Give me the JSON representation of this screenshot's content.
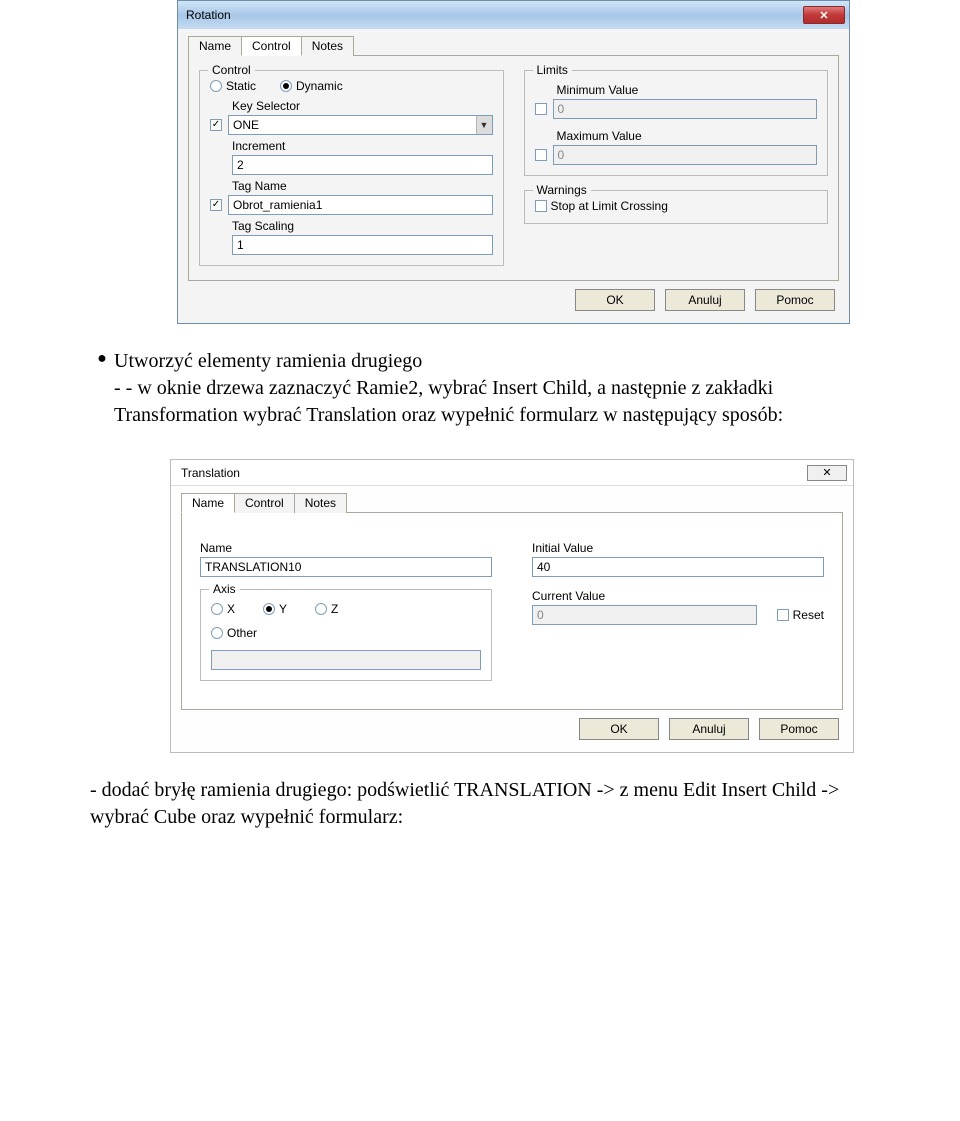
{
  "dialog1": {
    "title": "Rotation",
    "close": "✕",
    "tabs": {
      "name": "Name",
      "control": "Control",
      "notes": "Notes"
    },
    "control": {
      "legend": "Control",
      "radio": {
        "static": "Static",
        "dynamic": "Dynamic"
      },
      "keySelectorLabel": "Key Selector",
      "keySelectorValue": "ONE",
      "incrementLabel": "Increment",
      "incrementValue": "2",
      "tagNameLabel": "Tag Name",
      "tagNameValue": "Obrot_ramienia1",
      "tagScalingLabel": "Tag Scaling",
      "tagScalingValue": "1"
    },
    "limits": {
      "legend": "Limits",
      "minLabel": "Minimum Value",
      "minValue": "0",
      "maxLabel": "Maximum Value",
      "maxValue": "0"
    },
    "warnings": {
      "legend": "Warnings",
      "stopLabel": "Stop at Limit Crossing"
    },
    "buttons": {
      "ok": "OK",
      "anuluj": "Anuluj",
      "pomoc": "Pomoc"
    }
  },
  "paragraph1": {
    "line1": "Utworzyć elementy ramienia drugiego",
    "line2": "- - w oknie drzewa zaznaczyć Ramie2, wybrać Insert Child, a następnie z zakładki Transformation wybrać Translation oraz wypełnić formularz w następujący sposób:"
  },
  "dialog2": {
    "title": "Translation",
    "close": "✕",
    "tabs": {
      "name": "Name",
      "control": "Control",
      "notes": "Notes"
    },
    "nameTab": {
      "nameLabel": "Name",
      "nameValue": "TRANSLATION10",
      "initialLabel": "Initial Value",
      "initialValue": "40",
      "axisLegend": "Axis",
      "axis": {
        "x": "X",
        "y": "Y",
        "z": "Z",
        "other": "Other"
      },
      "otherValue": "",
      "currentLabel": "Current Value",
      "currentValue": "0",
      "resetLabel": "Reset"
    },
    "buttons": {
      "ok": "OK",
      "anuluj": "Anuluj",
      "pomoc": "Pomoc"
    }
  },
  "paragraph2": "- dodać bryłę ramienia drugiego: podświetlić TRANSLATION -> z menu Edit Insert Child -> wybrać Cube oraz wypełnić formularz:"
}
